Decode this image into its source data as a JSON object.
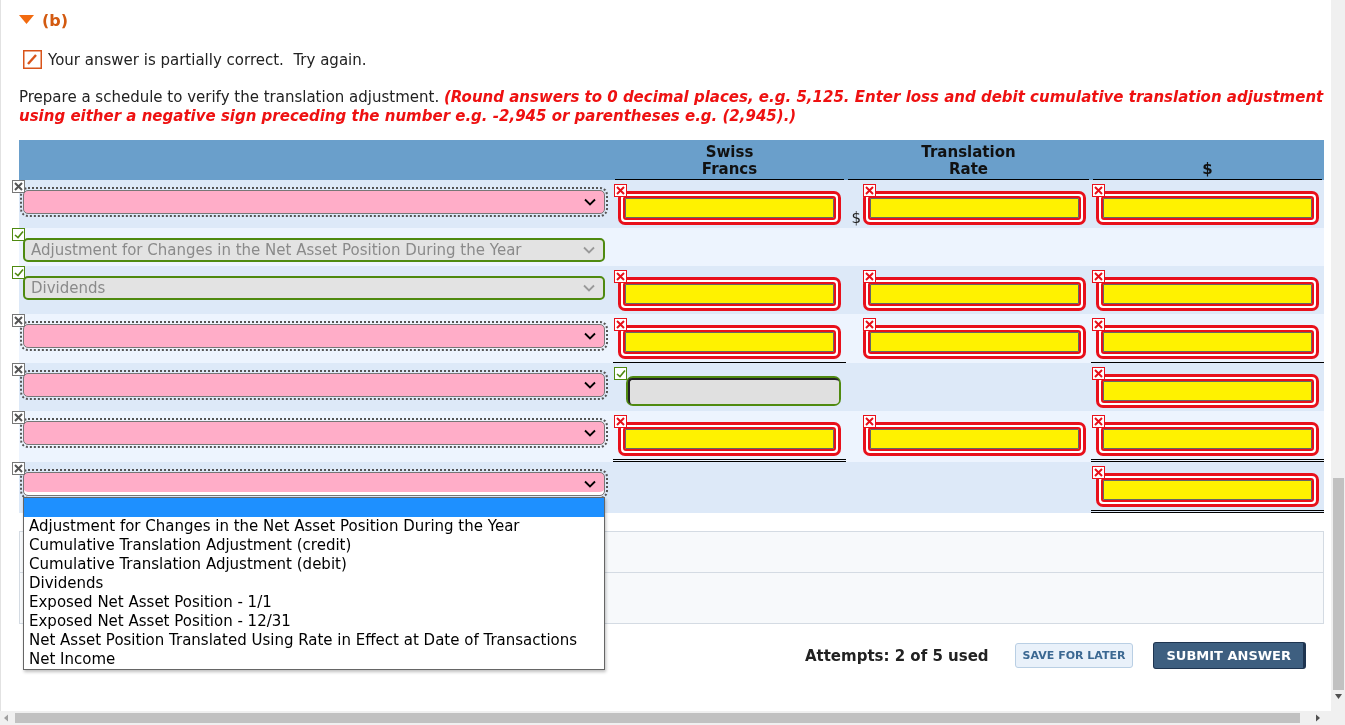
{
  "part": {
    "label": "(b)",
    "expanded": true
  },
  "feedback": "Your answer is partially correct.  Try again.",
  "instructions": "Prepare a schedule to verify the translation adjustment. **(Round answers to 0 decimal places, e.g. 5,125. Enter loss and debit cumulative translation adjustment using either a negative sign preceding the number e.g. -2,945 or parentheses e.g. (2,945).)**",
  "table": {
    "columns": [
      {
        "label": "Swiss Francs"
      },
      {
        "label": "Translation Rate"
      },
      {
        "label": "$"
      }
    ],
    "rows": [
      {
        "select": {
          "correct": false,
          "disabled": false,
          "open": false
        },
        "cells": [
          {
            "kind": "input",
            "correct": false,
            "underline": false,
            "double_underline": false
          },
          {
            "kind": "input",
            "correct": false,
            "underline": false,
            "double_underline": false,
            "prefix": "$"
          },
          {
            "kind": "input",
            "correct": false,
            "underline": false,
            "double_underline": false
          }
        ]
      },
      {
        "select": {
          "value": "Adjustment for Changes in the Net Asset Position During the Year",
          "correct": true,
          "disabled": true,
          "open": false
        },
        "cells": [
          {
            "kind": "blank",
            "underline": false,
            "double_underline": false
          },
          {
            "kind": "blank",
            "underline": false,
            "double_underline": false
          },
          {
            "kind": "blank",
            "underline": false,
            "double_underline": false
          }
        ]
      },
      {
        "select": {
          "value": "Dividends",
          "correct": true,
          "disabled": true,
          "open": false
        },
        "cells": [
          {
            "kind": "input",
            "correct": false,
            "underline": false,
            "double_underline": false
          },
          {
            "kind": "input",
            "correct": false,
            "underline": false,
            "double_underline": false
          },
          {
            "kind": "input",
            "correct": false,
            "underline": false,
            "double_underline": false
          }
        ]
      },
      {
        "select": {
          "correct": false,
          "disabled": false,
          "open": false
        },
        "cells": [
          {
            "kind": "input",
            "correct": false,
            "underline": true,
            "double_underline": false
          },
          {
            "kind": "input",
            "correct": false,
            "underline": false,
            "double_underline": false
          },
          {
            "kind": "input",
            "correct": false,
            "underline": true,
            "double_underline": false
          }
        ]
      },
      {
        "select": {
          "correct": false,
          "disabled": false,
          "open": false
        },
        "cells": [
          {
            "kind": "input",
            "correct": true,
            "underline": false,
            "double_underline": false
          },
          {
            "kind": "blank",
            "underline": false,
            "double_underline": false
          },
          {
            "kind": "input",
            "correct": false,
            "underline": false,
            "double_underline": false
          }
        ]
      },
      {
        "select": {
          "correct": false,
          "disabled": false,
          "open": false
        },
        "cells": [
          {
            "kind": "input",
            "correct": false,
            "underline": false,
            "double_underline": true
          },
          {
            "kind": "input",
            "correct": false,
            "underline": false,
            "double_underline": false
          },
          {
            "kind": "input",
            "correct": false,
            "underline": false,
            "double_underline": true
          }
        ]
      },
      {
        "select": {
          "correct": false,
          "disabled": false,
          "open": true
        },
        "cells": [
          {
            "kind": "blank",
            "underline": false,
            "double_underline": false
          },
          {
            "kind": "blank",
            "underline": false,
            "double_underline": false
          },
          {
            "kind": "input",
            "correct": false,
            "underline": false,
            "double_underline": true
          }
        ]
      }
    ],
    "dropdown": {
      "blank_highlighted": true,
      "options": [
        {
          "label": "Adjustment for Changes in the Net Asset Position During the Year",
          "selected": false
        },
        {
          "label": "Cumulative Translation Adjustment (credit)",
          "selected": false
        },
        {
          "label": "Cumulative Translation Adjustment (debit)",
          "selected": false
        },
        {
          "label": "Dividends",
          "selected": false
        },
        {
          "label": "Exposed Net Asset Position - 1/1",
          "selected": false
        },
        {
          "label": "Exposed Net Asset Position - 12/31",
          "selected": false
        },
        {
          "label": "Net Asset Position Translated Using Rate in Effect at Date of Transactions",
          "selected": false
        },
        {
          "label": "Net Income",
          "selected": false
        }
      ]
    }
  },
  "footer": {
    "attempts": "Attempts: 2 of 5 used",
    "buttons": [
      {
        "kind": "secondary",
        "label": "SAVE FOR LATER"
      },
      {
        "kind": "primary",
        "label": "SUBMIT ANSWER"
      }
    ]
  }
}
